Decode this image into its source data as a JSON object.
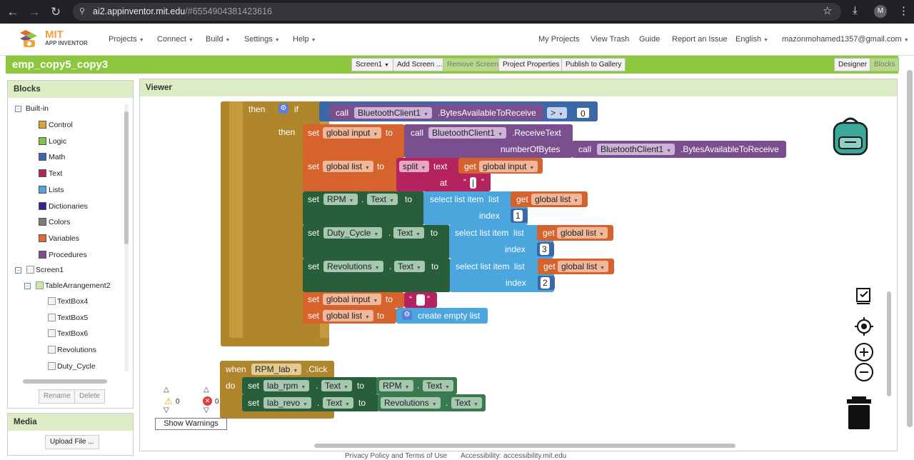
{
  "browser": {
    "url_host": "ai2.appinventor.mit.edu",
    "url_path": "/#6554904381423616",
    "avatar": "M"
  },
  "header": {
    "logo_main": "MIT",
    "logo_sub": "APP INVENTOR",
    "menus": [
      "Projects",
      "Connect",
      "Build",
      "Settings",
      "Help"
    ],
    "right_links": [
      "My Projects",
      "View Trash",
      "Guide",
      "Report an Issue",
      "English"
    ],
    "user": "mazonmohamed1357@gmail.com"
  },
  "projectbar": {
    "name": "emp_copy5_copy3",
    "screen": "Screen1",
    "add_screen": "Add Screen ...",
    "remove_screen": "Remove Screen",
    "properties": "Project Properties",
    "publish": "Publish to Gallery",
    "designer": "Designer",
    "blocks": "Blocks"
  },
  "blocks_panel": {
    "title": "Blocks",
    "builtin": "Built-in",
    "categories": [
      {
        "label": "Control",
        "color": "#d6a53b"
      },
      {
        "label": "Logic",
        "color": "#83c04a"
      },
      {
        "label": "Math",
        "color": "#3a68a8"
      },
      {
        "label": "Text",
        "color": "#b5235e"
      },
      {
        "label": "Lists",
        "color": "#4aa6dc"
      },
      {
        "label": "Dictionaries",
        "color": "#2d2496"
      },
      {
        "label": "Colors",
        "color": "#7a7a7a"
      },
      {
        "label": "Variables",
        "color": "#e06a30"
      },
      {
        "label": "Procedures",
        "color": "#7b4f8e"
      }
    ],
    "screen": "Screen1",
    "arrangement": "TableArrangement2",
    "components": [
      "TextBox4",
      "TextBox5",
      "TextBox6",
      "Revolutions",
      "Duty_Cycle"
    ],
    "rename": "Rename",
    "delete": "Delete"
  },
  "media_panel": {
    "title": "Media",
    "upload": "Upload File ..."
  },
  "viewer": {
    "title": "Viewer",
    "warn_count": "0",
    "error_count": "0",
    "show_warnings": "Show Warnings"
  },
  "code": {
    "then": "then",
    "if": "if",
    "call": "call",
    "bt": "BluetoothClient1",
    "bytes_avail": ".BytesAvailableToReceive",
    "gt": ">",
    "zero": "0",
    "set": "set",
    "to": "to",
    "global_input": "global input",
    "receive_text": ".ReceiveText",
    "number_of_bytes": "numberOfBytes",
    "global_list": "global list",
    "split": "split",
    "text": "text",
    "get": "get",
    "at": "at",
    "pipe": "|",
    "rpm": "RPM",
    "text_prop": "Text",
    "select_list_item": "select list item",
    "list": "list",
    "index": "index",
    "idx1": "1",
    "duty": "Duty_Cycle",
    "idx3": "3",
    "revolutions": "Revolutions",
    "idx2": "2",
    "create_empty_list": "create empty list",
    "when": "when",
    "rpm_lab": "RPM_lab",
    "click": ".Click",
    "do": "do",
    "lab_rpm": "lab_rpm",
    "lab_revo": "lab_revo",
    "dot": "."
  },
  "footer": {
    "privacy": "Privacy Policy and Terms of Use",
    "accessibility": "Accessibility: accessibility.mit.edu"
  }
}
